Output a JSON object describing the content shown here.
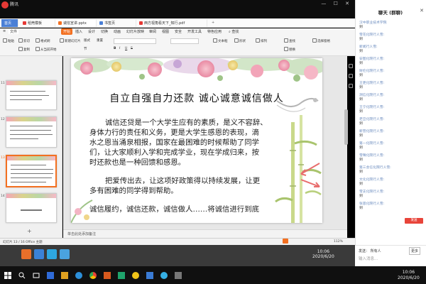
{
  "window": {
    "app_title": "腾讯"
  },
  "doc_tabs": [
    {
      "label": "首页",
      "color": "#4a7fd6"
    },
    {
      "label": "稻壳模板",
      "color": "#e53935"
    },
    {
      "label": "诚信宣讲.pptx",
      "color": "#f37021"
    },
    {
      "label": "书签页",
      "color": "#4a7fd6"
    },
    {
      "label": "西方视角看天下_知行.pdf",
      "color": "#e53935"
    }
  ],
  "ribbon_tabs": [
    "文件",
    "开始",
    "插入",
    "设计",
    "切换",
    "动画",
    "幻灯片放映",
    "审阅",
    "视图",
    "安全",
    "开发工具",
    "特色应用",
    "查找"
  ],
  "ribbon_tools": [
    "粘贴",
    "剪切",
    "复制",
    "格式刷",
    "从当前开始",
    "新建幻灯片",
    "版式",
    "节",
    "重置",
    "B",
    "I",
    "U",
    "S",
    "文本框",
    "形状",
    "排列",
    "查找",
    "替换",
    "选择窗格"
  ],
  "thumbnails": [
    {
      "num": "11"
    },
    {
      "num": "12"
    },
    {
      "num": "13"
    },
    {
      "num": "14"
    }
  ],
  "slide": {
    "title": "自立自强自力还款   诚心诚意诚信做人",
    "para1_lines": [
      "诚信还贷是一个大学生应有的素质，是义不容辞、",
      "身体力行的责任和义务，更是大学生感恩的表现，滴",
      "水之恩当涌泉相报，国家在最困难的时候帮助了同学",
      "们，让大家顺利入学和完成学业，现在学成归来，按",
      "时还款也是一种回馈和感恩。"
    ],
    "para2_lines": [
      "把爱传出去，让这项好政策得以持续发展，让更",
      "多有困难的同学得到帮助。"
    ],
    "closing": "诚信履约，诚信还款，诚信做人……将诚信进行到底"
  },
  "notes_placeholder": "单击此处添加备注",
  "status": {
    "slide": "幻灯片 13 / 16",
    "theme": "Office 主题",
    "zoom": "112%"
  },
  "viewer_clock": {
    "time": "10:06",
    "date": "2020/6/20"
  },
  "chat": {
    "title": "聊天 (群聊)",
    "messages": [
      {
        "name": "汉中职业技术学院",
        "text": "到"
      },
      {
        "name": "雪花化院行人雪:",
        "text": "到"
      },
      {
        "name": "新闻行人雪:",
        "text": "到"
      },
      {
        "name": "安图化院行人雪:",
        "text": "到"
      },
      {
        "name": "财伦化院行人雪:",
        "text": "到"
      },
      {
        "name": "王吏化院行人雪:",
        "text": "到"
      },
      {
        "name": "测信化院行人雪:",
        "text": "到"
      },
      {
        "name": "王宁化院行人雪:",
        "text": "到"
      },
      {
        "name": "老旦化院行人雪:",
        "text": "到"
      },
      {
        "name": "新营化院行人雪:",
        "text": "到"
      },
      {
        "name": "第一化院行人雪:",
        "text": "到"
      },
      {
        "name": "雪晴化院行人雪:",
        "text": "到"
      },
      {
        "name": "第三会信化院行人雪:",
        "text": "到"
      },
      {
        "name": "文化化院行人雪:",
        "text": "到"
      },
      {
        "name": "雪支化院行人雪:",
        "text": "到"
      },
      {
        "name": "张思化院行人雪:",
        "text": "到"
      }
    ],
    "send_to_label": "发送：  所有人",
    "send_button": "发送",
    "more_label": "更多",
    "input_placeholder": "输入消息..."
  },
  "taskbar": {
    "time": "10:06",
    "date": "2020/6/20"
  }
}
